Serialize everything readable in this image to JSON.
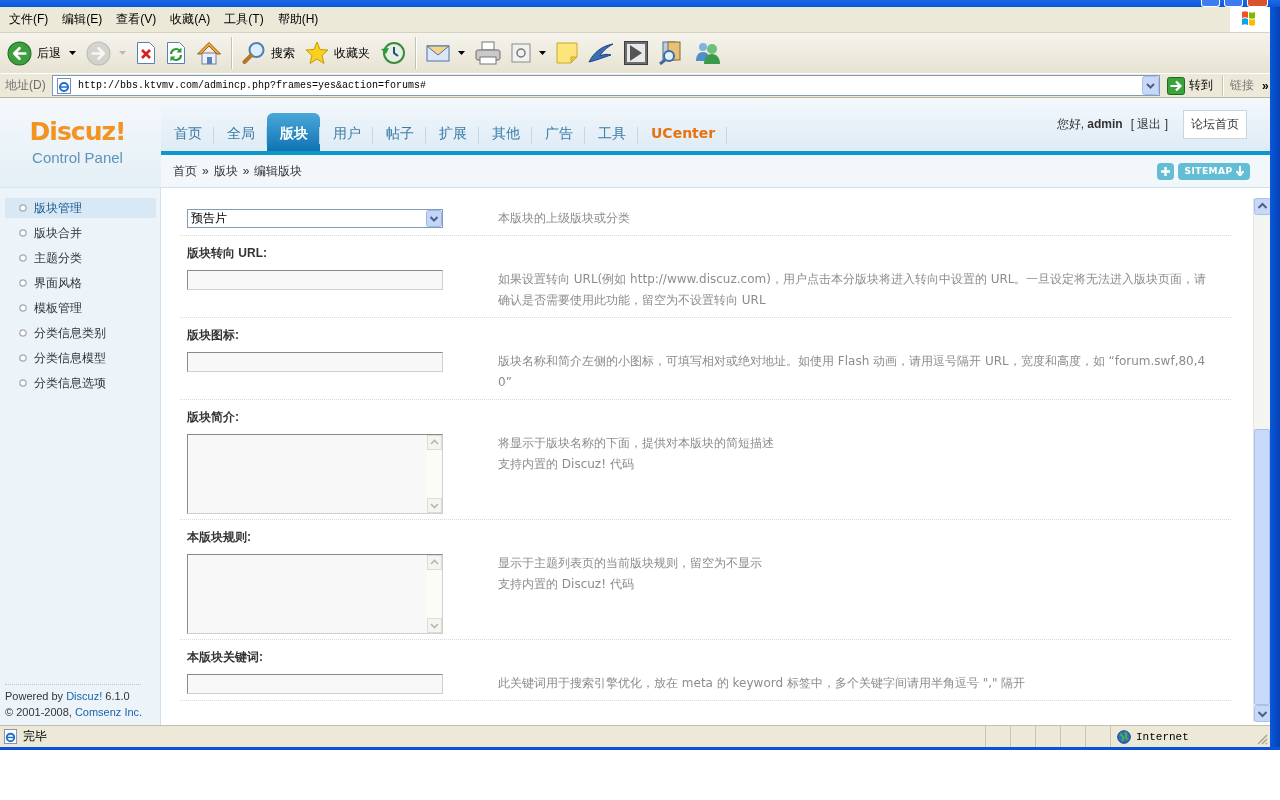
{
  "menu_bar": {
    "items": [
      "文件(F)",
      "编辑(E)",
      "查看(V)",
      "收藏(A)",
      "工具(T)",
      "帮助(H)"
    ]
  },
  "toolbar": {
    "items": [
      {
        "kind": "back",
        "label": "后退",
        "dropdown": true,
        "disabled": false
      },
      {
        "kind": "forward",
        "dropdown": true,
        "disabled": true
      },
      {
        "kind": "stop",
        "dropdown": false,
        "disabled": false
      },
      {
        "kind": "refresh",
        "dropdown": false,
        "disabled": false
      },
      {
        "kind": "home",
        "dropdown": false,
        "disabled": false
      },
      {
        "kind": "separator"
      },
      {
        "kind": "search",
        "label": "搜索",
        "dropdown": false,
        "disabled": false
      },
      {
        "kind": "favorites",
        "label": "收藏夹",
        "dropdown": false,
        "disabled": false
      },
      {
        "kind": "history",
        "dropdown": false,
        "disabled": false
      },
      {
        "kind": "separator"
      },
      {
        "kind": "mail",
        "dropdown": true,
        "disabled": false
      },
      {
        "kind": "print",
        "dropdown": false,
        "disabled": false
      },
      {
        "kind": "edit",
        "dropdown": true,
        "disabled": false
      },
      {
        "kind": "note",
        "dropdown": false,
        "disabled": false
      },
      {
        "kind": "messenger",
        "dropdown": false,
        "disabled": false
      },
      {
        "kind": "tile",
        "dropdown": false,
        "disabled": false
      },
      {
        "kind": "research",
        "dropdown": false,
        "disabled": false
      },
      {
        "kind": "contacts",
        "dropdown": false,
        "disabled": false
      }
    ]
  },
  "address_bar": {
    "label": "地址(D)",
    "url": "http://bbs.ktvmv.com/admincp.php?frames=yes&action=forums#",
    "go_button": "转到",
    "links": "链接",
    "more": "»"
  },
  "header": {
    "logo": "Discuz!",
    "subtitle": "Control Panel",
    "nav": [
      {
        "label": "首页",
        "kind": "section",
        "selected": false
      },
      {
        "label": "全局",
        "kind": "section",
        "selected": false
      },
      {
        "label": "版块",
        "kind": "section",
        "selected": true
      },
      {
        "label": "用户",
        "kind": "section",
        "selected": false
      },
      {
        "label": "帖子",
        "kind": "section",
        "selected": false
      },
      {
        "label": "扩展",
        "kind": "section",
        "selected": false
      },
      {
        "label": "其他",
        "kind": "section",
        "selected": false
      },
      {
        "label": "广告",
        "kind": "section",
        "selected": false
      },
      {
        "label": "工具",
        "kind": "section",
        "selected": false
      },
      {
        "label": "UCenter",
        "kind": "app",
        "selected": false
      }
    ],
    "greeting": "您好, **admin**",
    "logout": "[ 退出 ]",
    "forum_home": "论坛首页"
  },
  "breadcrumb": [
    {
      "kind": "link",
      "text": "首页"
    },
    {
      "kind": "separator",
      "text": "»"
    },
    {
      "kind": "link",
      "text": "版块"
    },
    {
      "kind": "separator",
      "text": "»"
    },
    {
      "kind": "current",
      "text": "编辑版块"
    }
  ],
  "sitemap": {
    "label": "SITEMAP"
  },
  "sidebar": {
    "items": [
      {
        "label": "版块管理",
        "selected": true
      },
      {
        "label": "版块合并",
        "selected": false
      },
      {
        "label": "主题分类",
        "selected": false
      },
      {
        "label": "界面风格",
        "selected": false
      },
      {
        "label": "模板管理",
        "selected": false
      },
      {
        "label": "分类信息类别",
        "selected": false
      },
      {
        "label": "分类信息模型",
        "selected": false
      },
      {
        "label": "分类信息选项",
        "selected": false
      }
    ],
    "powered": {
      "prefix": "Powered by",
      "link": "Discuz!",
      "suffix": "6.1.0"
    },
    "copyright": {
      "prefix": "© 2001-2008,",
      "link": "Comsenz Inc."
    }
  },
  "form": {
    "fields": [
      {
        "kind": "select",
        "value": "预告片",
        "description": [
          "本版块的上级版块或分类"
        ]
      },
      {
        "kind": "text",
        "label": "版块转向 URL:",
        "description": [
          "如果设置转向 URL(例如 http://www.discuz.com)，用户点击本分版块将进入转向中设置的 URL。一旦设定将无法进入版块页面，请确认是否需要使用此功能，留空为不设置转向 URL"
        ]
      },
      {
        "kind": "text",
        "label": "版块图标:",
        "description": [
          "版块名称和简介左侧的小图标，可填写相对或绝对地址。如使用 Flash 动画，请用逗号隔开 URL，宽度和高度，如 “forum.swf,80,40”"
        ]
      },
      {
        "kind": "textarea",
        "label": "版块简介:",
        "description": [
          "将显示于版块名称的下面，提供对本版块的简短描述",
          "支持内置的 Discuz! 代码"
        ]
      },
      {
        "kind": "textarea",
        "label": "本版块规则:",
        "description": [
          "显示于主题列表页的当前版块规则，留空为不显示",
          "支持内置的 Discuz! 代码"
        ]
      },
      {
        "kind": "text",
        "label": "本版块关键词:",
        "description": [
          "此关键词用于搜索引擎优化，放在 meta 的 keyword 标签中，多个关键字间请用半角逗号 \",\" 隔开"
        ]
      }
    ]
  },
  "status_bar": {
    "text": "完毕",
    "zone": "Internet"
  }
}
